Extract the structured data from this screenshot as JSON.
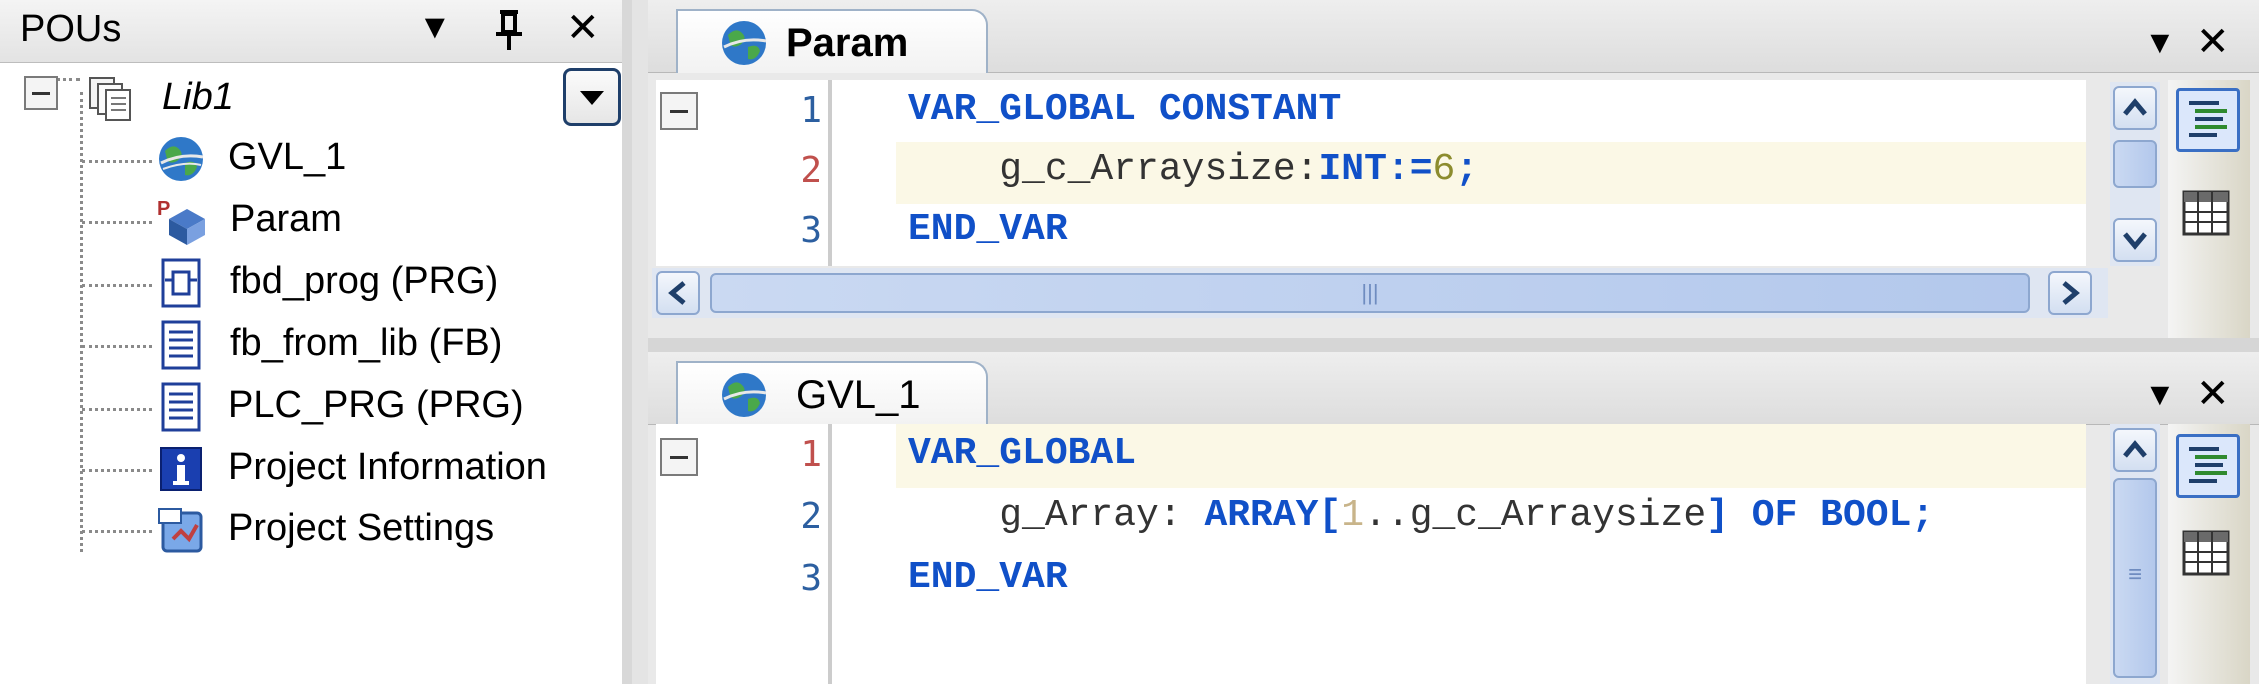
{
  "pous_panel": {
    "title": "POUs",
    "dropdown_glyph": "▼",
    "pin_glyph": "📌",
    "close_glyph": "✕",
    "root": {
      "label": "Lib1",
      "expander": "collapse"
    },
    "items": [
      {
        "label": "GVL_1",
        "icon": "global-variable-list-icon"
      },
      {
        "label": "Param",
        "icon": "parameter-list-icon"
      },
      {
        "label": "fbd_prog (PRG)",
        "icon": "fbd-program-icon"
      },
      {
        "label": "fb_from_lib (FB)",
        "icon": "function-block-icon"
      },
      {
        "label": "PLC_PRG (PRG)",
        "icon": "program-icon"
      },
      {
        "label": "Project Information",
        "icon": "info-icon"
      },
      {
        "label": "Project Settings",
        "icon": "settings-icon"
      }
    ]
  },
  "editor_param": {
    "tab_label": "Param",
    "dropdown_glyph": "▼",
    "close_glyph": "✕",
    "line_numbers": [
      "1",
      "2",
      "3"
    ],
    "lines": {
      "l1_kw": "VAR_GLOBAL CONSTANT",
      "l2_indent": "    ",
      "l2_name": "g_c_Arraysize",
      "l2_colon": ":",
      "l2_type": "INT:=",
      "l2_value": "6",
      "l2_end": ";",
      "l3_kw": "END_VAR"
    },
    "hscroll_grip": "|||"
  },
  "editor_gvl": {
    "tab_label": "GVL_1",
    "dropdown_glyph": "▼",
    "close_glyph": "✕",
    "line_numbers": [
      "1",
      "2",
      "3"
    ],
    "lines": {
      "l1_kw": "VAR_GLOBAL",
      "l2_indent": "    ",
      "l2_name": "g_Array: ",
      "l2_array": "ARRAY[",
      "l2_lower": "1",
      "l2_range": "..g_c_Arraysize",
      "l2_of": "] OF BOOL;",
      "l3_kw": "END_VAR"
    },
    "vscroll_grip": "≡"
  },
  "colors": {
    "keyword": "#1050c8",
    "number": "#8c8c2e",
    "line_num_current": "#c0504d",
    "line_num_other": "#2c5fa0",
    "highlight": "#fbf8e6"
  }
}
